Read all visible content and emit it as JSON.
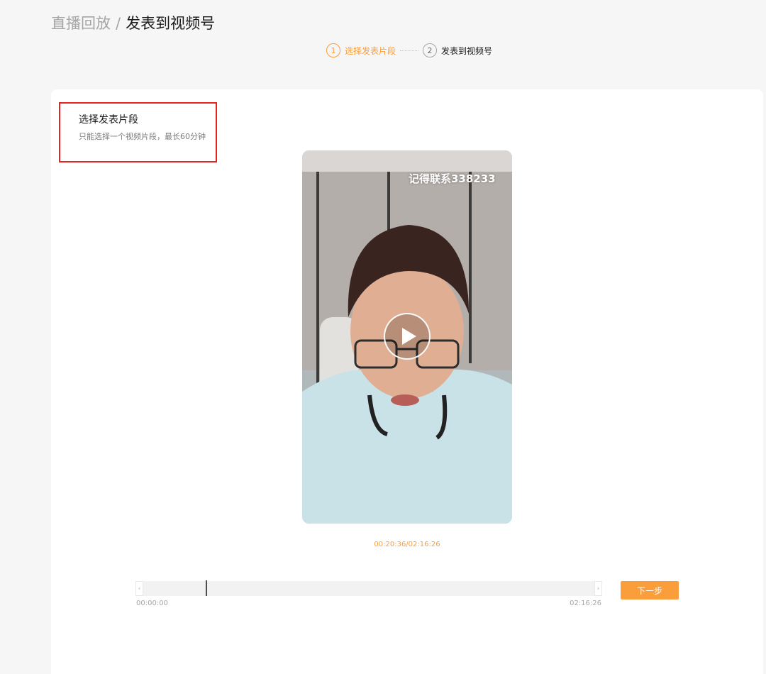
{
  "breadcrumb": {
    "parent": "直播回放",
    "separator": "/",
    "current": "发表到视频号"
  },
  "steps": [
    {
      "number": "1",
      "label": "选择发表片段",
      "active": true
    },
    {
      "number": "2",
      "label": "发表到视频号",
      "active": false
    }
  ],
  "section": {
    "title": "选择发表片段",
    "description": "只能选择一个视频片段，最长60分钟"
  },
  "video": {
    "overlay_text": "记得联系338233",
    "current_time": "00:20:36/02:16:26"
  },
  "timeline": {
    "start_label": "00:00:00",
    "end_label": "02:16:26",
    "prev_arrow": "‹",
    "next_arrow": "›",
    "marker_fraction": 0.151
  },
  "actions": {
    "next_label": "下一步"
  },
  "colors": {
    "accent": "#fa9d3b",
    "highlight_border": "#e8231f"
  }
}
